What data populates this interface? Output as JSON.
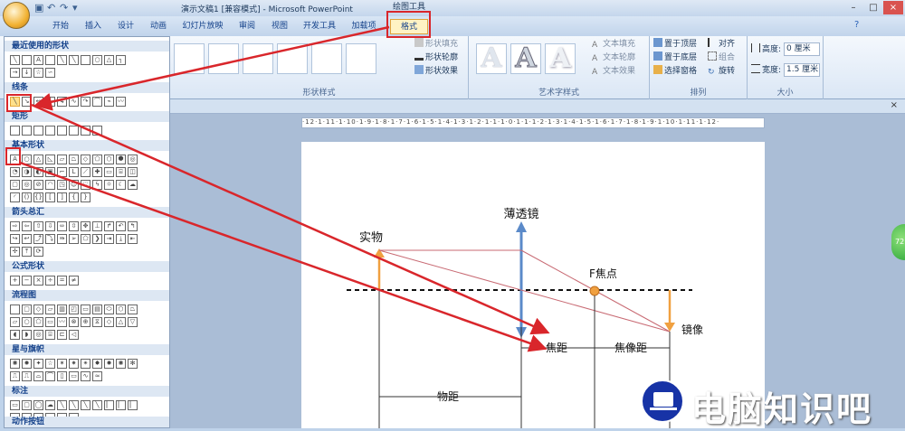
{
  "window": {
    "title": "演示文稿1 [兼容模式] - Microsoft PowerPoint",
    "context_tool": "绘图工具"
  },
  "tabs": [
    "开始",
    "插入",
    "设计",
    "动画",
    "幻灯片放映",
    "审阅",
    "视图",
    "开发工具",
    "加载项",
    "格式"
  ],
  "ribbon": {
    "shape_styles": {
      "fill": "形状填充",
      "outline": "形状轮廓",
      "effects": "形状效果",
      "label": "形状样式"
    },
    "wordart": {
      "sample": "A",
      "fill": "文本填充",
      "outline": "文本轮廓",
      "effects": "文本效果",
      "label": "艺术字样式"
    },
    "arrange": {
      "bring_front": "置于顶层",
      "send_back": "置于底层",
      "selection_pane": "选择窗格",
      "align": "对齐",
      "group": "组合",
      "rotate": "旋转",
      "label": "排列"
    },
    "size": {
      "height_label": "高度:",
      "height_value": "0 厘米",
      "width_label": "宽度:",
      "width_value": "1.5 厘米",
      "label": "大小"
    }
  },
  "shapes_menu": {
    "sections": [
      "最近使用的形状",
      "线条",
      "矩形",
      "基本形状",
      "箭头总汇",
      "公式形状",
      "流程图",
      "星与旗帜",
      "标注",
      "动作按钮"
    ]
  },
  "ruler": "·12·1·11·1·10·1·9·1·8·1·7·1·6·1·5·1·4·1·3·1·2·1·1·1·0·1·1·1·2·1·3·1·4·1·5·1·6·1·7·1·8·1·9·1·10·1·11·1·12·",
  "diagram": {
    "lens": "薄透镜",
    "object": "实物",
    "focal_point": "F焦点",
    "image": "镜像",
    "focal_length": "焦距",
    "image_distance": "焦像距",
    "object_distance": "物距"
  },
  "watermark": {
    "text": "电脑知识吧"
  },
  "colors": {
    "accent_red": "#d9262b",
    "lens_blue": "#5b8ac9",
    "object_orange": "#f0a040"
  }
}
